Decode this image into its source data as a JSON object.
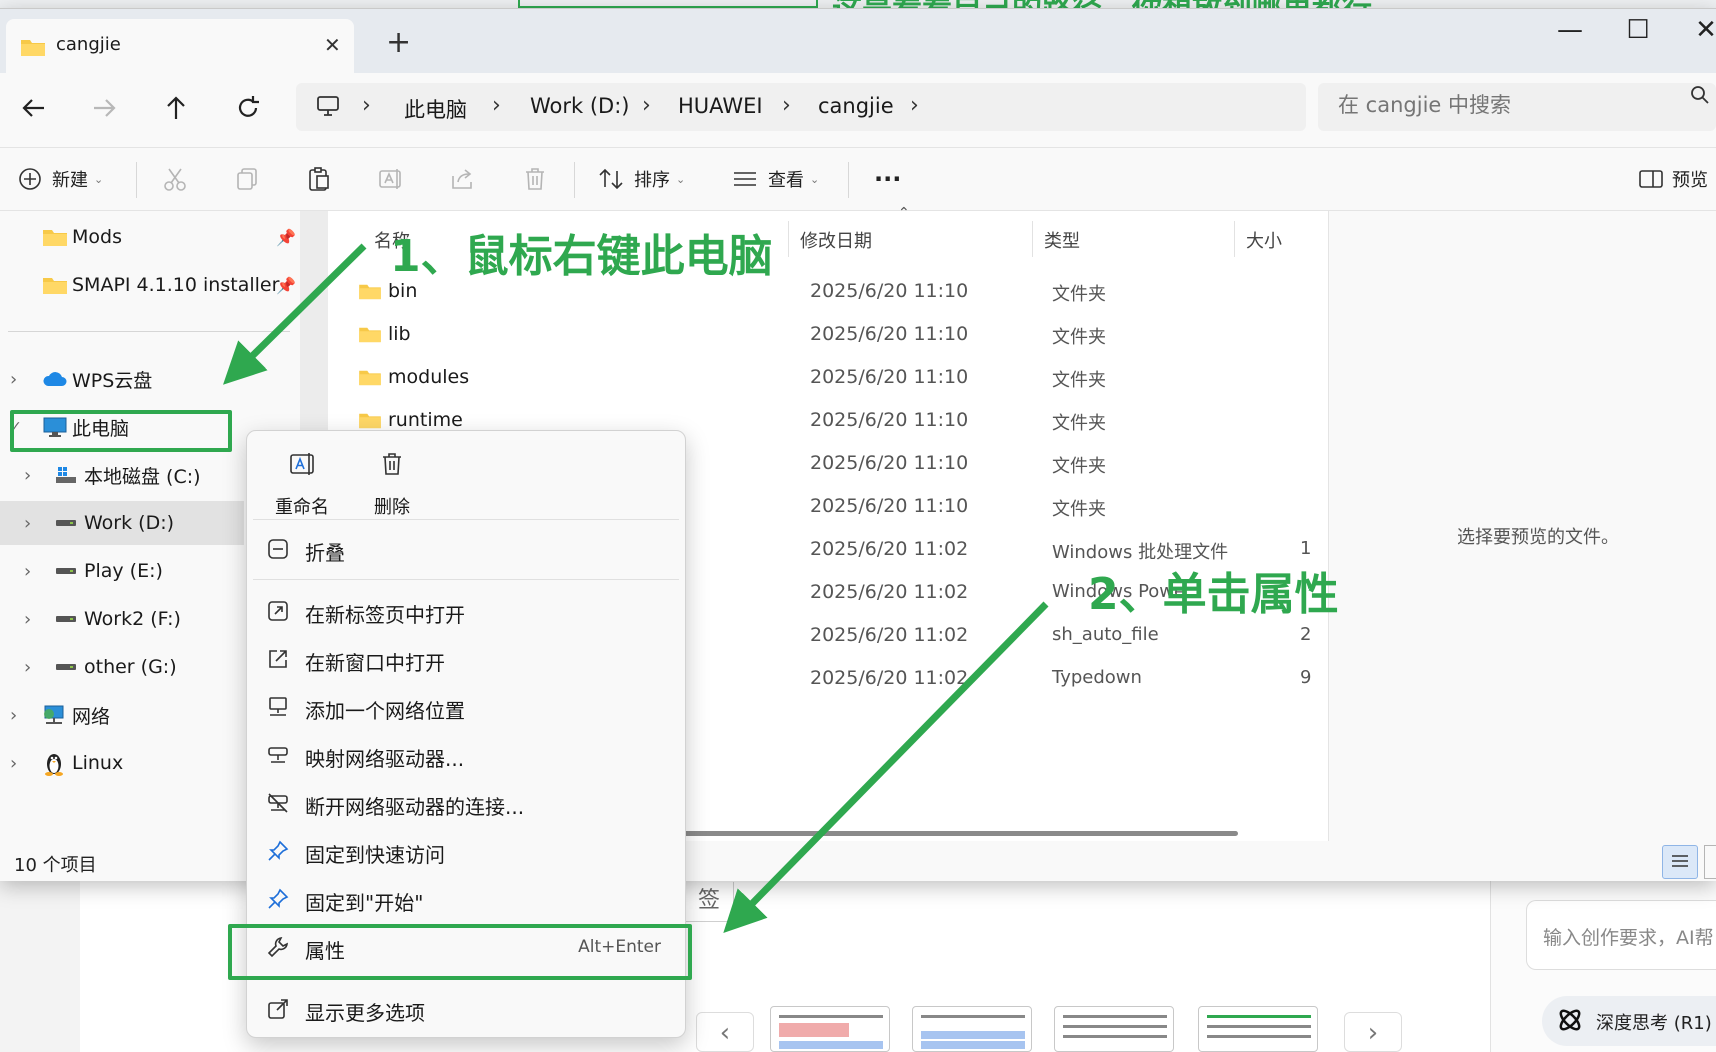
{
  "background": {
    "tag_label": "签",
    "ai_input_placeholder": "输入创作要求，AI帮",
    "deep_think": "深度思考 (R1)",
    "top_caption": "这是看看自己的路径，你想放到哪里都行",
    "nav_prev": "‹",
    "nav_next": "›"
  },
  "window": {
    "tab_title": "cangjie",
    "tab_close": "✕",
    "new_tab": "+",
    "minimize": "—",
    "maximize": "☐",
    "close": "✕"
  },
  "address": {
    "crumbs": [
      "此电脑",
      "Work (D:)",
      "HUAWEI",
      "cangjie"
    ],
    "separator": "›",
    "search_placeholder": "在 cangjie 中搜索"
  },
  "toolbar": {
    "new_label": "新建",
    "sort_label": "排序",
    "view_label": "查看",
    "more_label": "···",
    "preview_label": "预览"
  },
  "sidebar": {
    "quick": [
      {
        "label": "Mods"
      },
      {
        "label": "SMAPI 4.1.10 installer"
      }
    ],
    "tree": [
      {
        "label": "WPS云盘",
        "expander": "›"
      },
      {
        "label": "此电脑",
        "expander": "✓"
      },
      {
        "label": "本地磁盘 (C:)",
        "expander": "›"
      },
      {
        "label": "Work (D:)",
        "expander": "›"
      },
      {
        "label": "Play (E:)",
        "expander": "›"
      },
      {
        "label": "Work2 (F:)",
        "expander": "›"
      },
      {
        "label": "other (G:)",
        "expander": "›"
      },
      {
        "label": "网络",
        "expander": "›"
      },
      {
        "label": "Linux",
        "expander": "›"
      }
    ]
  },
  "columns": {
    "name": "名称",
    "modified": "修改日期",
    "type": "类型",
    "size": "大小"
  },
  "files": [
    {
      "name": "bin",
      "date": "2025/6/20 11:10",
      "type": "文件夹",
      "size": ""
    },
    {
      "name": "lib",
      "date": "2025/6/20 11:10",
      "type": "文件夹",
      "size": ""
    },
    {
      "name": "modules",
      "date": "2025/6/20 11:10",
      "type": "文件夹",
      "size": ""
    },
    {
      "name": "runtime",
      "date": "2025/6/20 11:10",
      "type": "文件夹",
      "size": ""
    },
    {
      "name": "",
      "date": "2025/6/20 11:10",
      "type": "文件夹",
      "size": ""
    },
    {
      "name": "",
      "date": "2025/6/20 11:10",
      "type": "文件夹",
      "size": ""
    },
    {
      "name": "",
      "date": "2025/6/20 11:02",
      "type": "Windows 批处理文件",
      "size": "1"
    },
    {
      "name": "",
      "date": "2025/6/20 11:02",
      "type": "Windows Powe",
      "size": ""
    },
    {
      "name": "",
      "date": "2025/6/20 11:02",
      "type": "sh_auto_file",
      "size": "2"
    },
    {
      "name": "",
      "date": "2025/6/20 11:02",
      "type": "Typedown",
      "size": "9"
    }
  ],
  "preview": {
    "empty_text": "选择要预览的文件。"
  },
  "status": {
    "count": "10 个项目"
  },
  "context_menu": {
    "rename": "重命名",
    "delete": "删除",
    "items": [
      {
        "label": "折叠",
        "shortcut": ""
      },
      {
        "label": "在新标签页中打开",
        "shortcut": ""
      },
      {
        "label": "在新窗口中打开",
        "shortcut": ""
      },
      {
        "label": "添加一个网络位置",
        "shortcut": ""
      },
      {
        "label": "映射网络驱动器...",
        "shortcut": ""
      },
      {
        "label": "断开网络驱动器的连接...",
        "shortcut": ""
      },
      {
        "label": "固定到快速访问",
        "shortcut": ""
      },
      {
        "label": "固定到\"开始\"",
        "shortcut": ""
      },
      {
        "label": "属性",
        "shortcut": "Alt+Enter"
      },
      {
        "label": "显示更多选项",
        "shortcut": ""
      }
    ]
  },
  "annotations": {
    "step1": "1、鼠标右键此电脑",
    "step2": "2、单击属性",
    "color": "#2fa84f"
  }
}
